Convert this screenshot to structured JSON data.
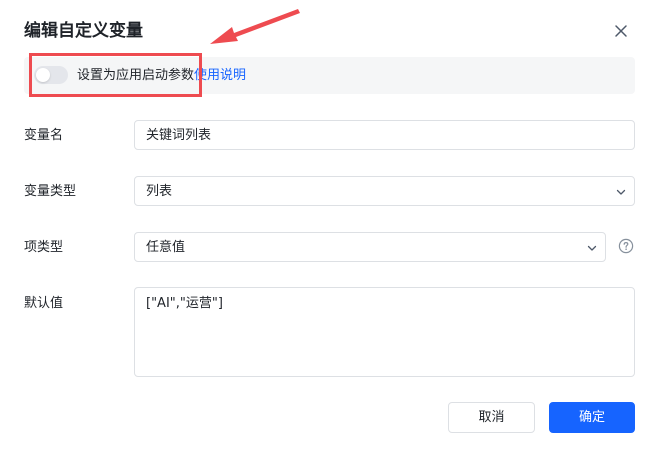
{
  "dialog": {
    "title": "编辑自定义变量",
    "close_icon": "close-icon"
  },
  "startup_toggle": {
    "label": "设置为应用启动参数",
    "link": "使用说明",
    "enabled": false
  },
  "fields": {
    "name": {
      "label": "变量名",
      "value": "关键词列表"
    },
    "type": {
      "label": "变量类型",
      "value": "列表"
    },
    "item_type": {
      "label": "项类型",
      "value": "任意值",
      "help_icon": "question-circle-icon"
    },
    "default": {
      "label": "默认值",
      "value": "[\"AI\",\"运营\"]"
    }
  },
  "buttons": {
    "cancel": "取消",
    "confirm": "确定"
  },
  "colors": {
    "primary": "#1664ff",
    "annotation": "#ee4b50",
    "toggle_bg": "#f5f6f7",
    "border": "#dde0e4"
  }
}
